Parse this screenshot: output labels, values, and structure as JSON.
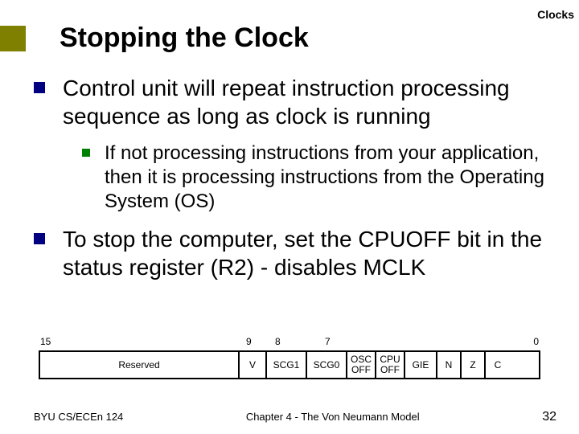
{
  "topic": "Clocks",
  "title": "Stopping the Clock",
  "bullets": {
    "b1": "Control unit will repeat instruction processing sequence as long as clock is running",
    "b1_sub1": "If not processing instructions from your application, then it is processing instructions from the Operating System (OS)",
    "b2": "To stop the computer, set the CPUOFF bit in the status register (R2) - disables MCLK"
  },
  "register": {
    "bits": {
      "b15": "15",
      "b9": "9",
      "b8": "8",
      "b7": "7",
      "b0": "0"
    },
    "fields": {
      "reserved": "Reserved",
      "v": "V",
      "scg1": "SCG1",
      "scg0": "SCG0",
      "oscoff": "OSC\nOFF",
      "cpuoff": "CPU\nOFF",
      "gie": "GIE",
      "n": "N",
      "z": "Z",
      "c": "C"
    }
  },
  "footer": {
    "left": "BYU CS/ECEn 124",
    "center": "Chapter 4 - The Von Neumann Model",
    "page": "32"
  }
}
